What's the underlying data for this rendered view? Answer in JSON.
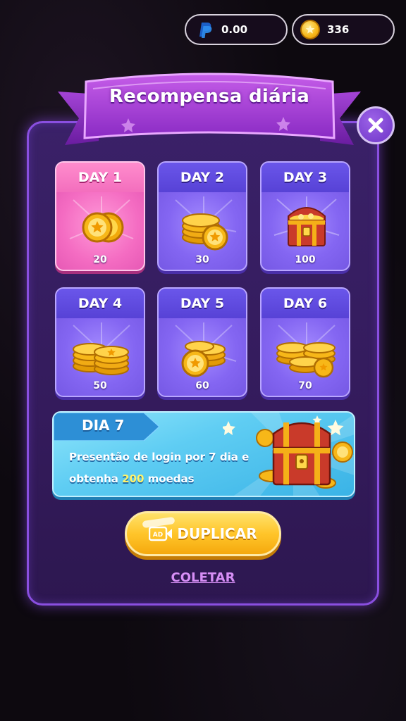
{
  "header": {
    "paypal_balance": "0.00",
    "coin_balance": "336"
  },
  "popup": {
    "title": "Recompensa diária",
    "days": [
      {
        "label": "DAY 1",
        "amount": "20",
        "state": "active",
        "art": "two-coins-icon"
      },
      {
        "label": "DAY 2",
        "amount": "30",
        "state": "upcoming",
        "art": "coin-stack-icon"
      },
      {
        "label": "DAY 3",
        "amount": "100",
        "state": "upcoming",
        "art": "treasure-chest-icon"
      },
      {
        "label": "DAY 4",
        "amount": "50",
        "state": "upcoming",
        "art": "coin-stacks-icon"
      },
      {
        "label": "DAY 5",
        "amount": "60",
        "state": "upcoming",
        "art": "coin-pile-icon"
      },
      {
        "label": "DAY 6",
        "amount": "70",
        "state": "upcoming",
        "art": "coin-heap-icon"
      }
    ],
    "day7": {
      "label": "DIA 7",
      "text_before": "Presentão de login por 7 dia e obtenha ",
      "highlight": "200",
      "text_after": " moedas"
    },
    "double_button": "DUPLICAR",
    "ad_badge": "AD",
    "collect_link": "COLETAR"
  },
  "colors": {
    "panel": "#3a2168",
    "active_card": "#f46cc2",
    "card": "#8466f2",
    "banner": "#5fcdf3",
    "button": "#ffc52a",
    "link": "#d68ef5",
    "highlight": "#fff36a"
  }
}
